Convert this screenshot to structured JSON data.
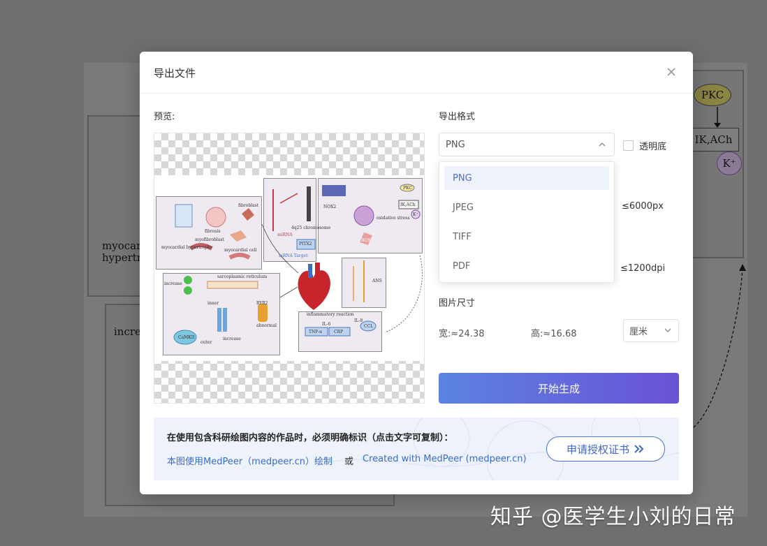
{
  "dialog": {
    "title": "导出文件",
    "close_icon": "close-icon"
  },
  "preview": {
    "label": "预览:",
    "figure_labels": {
      "fibroblast": "fibroblast",
      "fibrosis": "fibrosis",
      "myofibroblast": "myofibroblast",
      "myocardial_hypertrophy": "myocardial hypertrophy",
      "myocardial_cell": "myocardial cell",
      "mirna": "miRNA",
      "chromosome": "4q25 chromosome",
      "pitx2": "PITX2",
      "mrna_target": "mRNA Target",
      "nox2": "NOX2",
      "oxidative_stress": "oxidative stress",
      "pkc": "PKC",
      "ik_ach": "IK,ACh",
      "k": "K⁺",
      "ros": "ROS",
      "ans": "ANS",
      "sarcoplasmic_reticulum": "sarcoplasmic reticulum",
      "increase": "increase",
      "inner": "inner",
      "ryr2": "RYR2",
      "abnormal": "abnormal",
      "camkii": "CaMKII",
      "outer": "outer",
      "inflammatory_reaction": "inflammatory reaction",
      "il6": "IL-6",
      "il8": "IL-8",
      "tnf": "TNF-α",
      "crp": "CRP",
      "ccl": "CCL"
    }
  },
  "format": {
    "label": "导出格式",
    "selected": "PNG",
    "options": [
      "PNG",
      "JPEG",
      "TIFF",
      "PDF"
    ],
    "transparent_label": "透明底",
    "transparent_checked": false
  },
  "limits": {
    "max_px": "≤6000px",
    "max_dpi": "≤1200dpi"
  },
  "image_size": {
    "label": "图片尺寸",
    "width": "宽:≈24.38",
    "height": "高:≈16.68",
    "unit": "厘米"
  },
  "generate_label": "开始生成",
  "notice": {
    "title": "在使用包含科研绘图内容的作品时，必须明确标识（点击文字可复制）：",
    "credit_cn": "本图使用MedPeer（medpeer.cn）绘制",
    "or": "或",
    "credit_en": "Created with MedPeer (medpeer.cn)",
    "license_button": "申请授权证书"
  },
  "background": {
    "pkc": "PKC",
    "ik_ach": "IK,ACh",
    "k": "K⁺",
    "text1": "myocar",
    "text2": "hypertro",
    "text3": "increa"
  },
  "watermark": "知乎 @医学生小刘的日常",
  "colors": {
    "accent": "#4b6fc9",
    "button_gradient_start": "#5b83e2",
    "button_gradient_end": "#6a52d5"
  }
}
